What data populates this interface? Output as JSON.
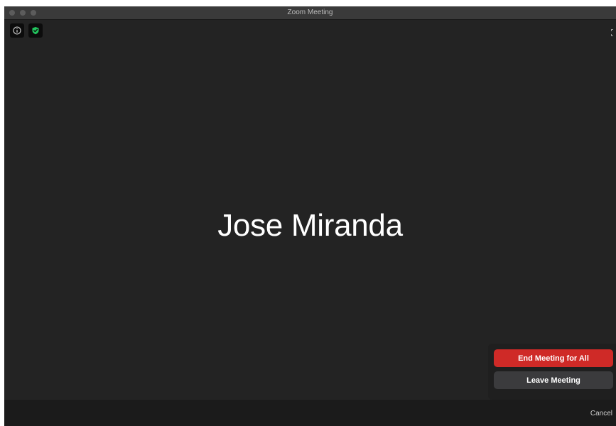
{
  "window": {
    "title": "Zoom Meeting"
  },
  "toolbar": {
    "info_icon": "info-icon",
    "security_icon": "shield-check-icon",
    "fullscreen_icon": "fullscreen-icon"
  },
  "main": {
    "participant_name": "Jose Miranda"
  },
  "end_meeting_menu": {
    "end_for_all_label": "End Meeting for All",
    "leave_label": "Leave Meeting"
  },
  "footer": {
    "cancel_label": "Cancel"
  },
  "colors": {
    "background": "#232323",
    "end_button": "#cf2a27",
    "leave_button": "#3b3b3d",
    "security_green": "#22c55e"
  }
}
